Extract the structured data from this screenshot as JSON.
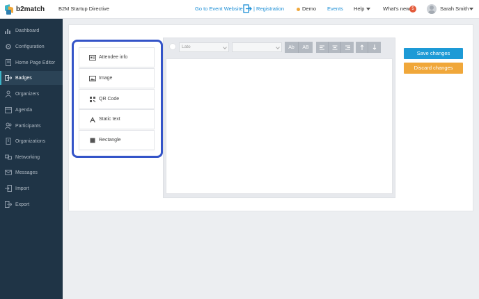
{
  "topbar": {
    "logo_text": "b2match",
    "event_name": "B2M Startup Directive",
    "goto_label": "Go to Event Website",
    "registration_label": "| Registration",
    "demo_label": "Demo",
    "events_label": "Events",
    "help_label": "Help",
    "whats_new_label": "What's new",
    "whats_new_count": "5",
    "user_name": "Sarah Smith",
    "accent_color": "#1d8fd6"
  },
  "sidebar": {
    "items": [
      {
        "label": "Dashboard",
        "icon": "dashboard-icon"
      },
      {
        "label": "Configuration",
        "icon": "gear-icon"
      },
      {
        "label": "Home Page Editor",
        "icon": "page-icon"
      },
      {
        "label": "Badges",
        "icon": "badge-icon",
        "active": true
      },
      {
        "label": "Organizers",
        "icon": "users-icon"
      },
      {
        "label": "Agenda",
        "icon": "calendar-icon"
      },
      {
        "label": "Participants",
        "icon": "participants-icon"
      },
      {
        "label": "Organizations",
        "icon": "building-icon"
      },
      {
        "label": "Networking",
        "icon": "network-icon"
      },
      {
        "label": "Messages",
        "icon": "mail-icon"
      },
      {
        "label": "Import",
        "icon": "import-icon"
      },
      {
        "label": "Export",
        "icon": "export-icon"
      }
    ]
  },
  "palette": {
    "items": [
      {
        "label": "Attendee info",
        "icon": "id-card-icon"
      },
      {
        "label": "Image",
        "icon": "image-icon"
      },
      {
        "label": "QR Code",
        "icon": "qr-code-icon"
      },
      {
        "label": "Static text",
        "icon": "text-icon"
      },
      {
        "label": "Rectangle",
        "icon": "rectangle-icon"
      }
    ]
  },
  "editor": {
    "font_value": "Lato",
    "size_value": "",
    "case_buttons": [
      "Ab",
      "AB"
    ]
  },
  "actions": {
    "save_label": "Save changes",
    "discard_label": "Discard changes"
  }
}
